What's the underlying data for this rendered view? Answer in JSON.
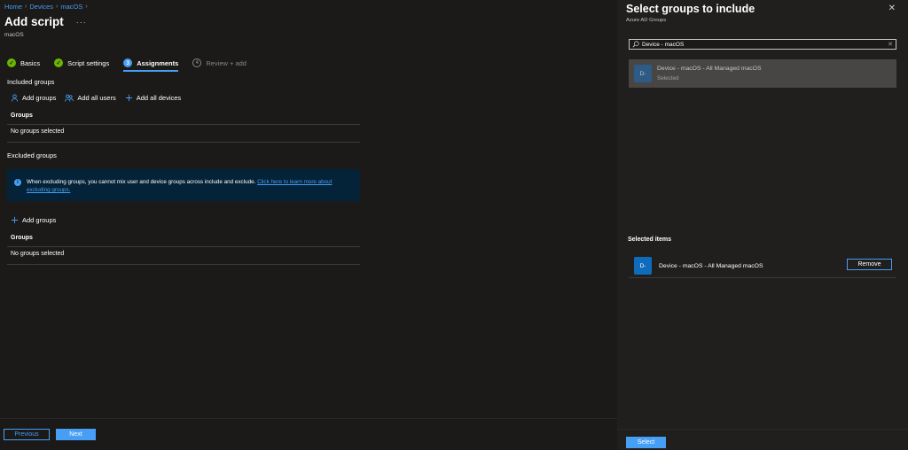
{
  "breadcrumb": [
    "Home",
    "Devices",
    "macOS"
  ],
  "page": {
    "title": "Add script",
    "more": "···",
    "subtitle": "macOS"
  },
  "wizard": {
    "steps": [
      {
        "label": "Basics",
        "state": "done",
        "marker": "✓"
      },
      {
        "label": "Script settings",
        "state": "done",
        "marker": "✓"
      },
      {
        "label": "Assignments",
        "state": "current",
        "marker": "3"
      },
      {
        "label": "Review + add",
        "state": "todo",
        "marker": "4"
      }
    ]
  },
  "included": {
    "label": "Included groups",
    "actions": {
      "add_groups": "Add groups",
      "add_all_users": "Add all users",
      "add_all_devices": "Add all devices"
    },
    "column": "Groups",
    "empty": "No groups selected"
  },
  "excluded": {
    "label": "Excluded groups",
    "info_text": "When excluding groups, you cannot mix user and device groups across include and exclude. ",
    "info_link": "Click here to learn more about excluding groups.",
    "add_groups": "Add groups",
    "column": "Groups",
    "empty": "No groups selected"
  },
  "footer": {
    "previous": "Previous",
    "next": "Next"
  },
  "panel": {
    "title": "Select groups to include",
    "subtitle": "Azure AD Groups",
    "search_value": "Device - macOS",
    "result": {
      "initials": "D-",
      "name": "Device - macOS - All Managed macOS",
      "state": "Selected"
    },
    "selected_label": "Selected items",
    "selected_item": {
      "initials": "D-",
      "name": "Device - macOS - All Managed macOS"
    },
    "remove": "Remove",
    "select": "Select"
  },
  "colors": {
    "accent": "#479ef5",
    "success": "#6bb700",
    "background": "#1b1a19",
    "panel": "#201f1e",
    "info_bar": "#042338"
  },
  "icons": [
    "check-icon",
    "user-icon",
    "users-icon",
    "plus-icon",
    "info-icon",
    "search-icon",
    "close-icon",
    "clear-icon"
  ]
}
